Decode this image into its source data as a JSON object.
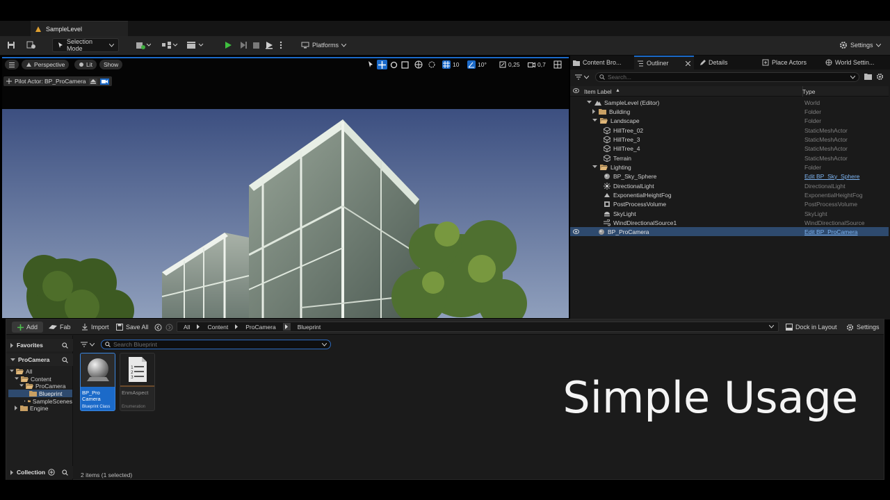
{
  "level_tab": {
    "title": "SampleLevel"
  },
  "toolbar": {
    "selection_mode": "Selection Mode",
    "platforms": "Platforms",
    "settings": "Settings"
  },
  "viewport": {
    "perspective": "Perspective",
    "lit": "Lit",
    "show": "Show",
    "grid_snap": "10",
    "rotation_snap": "10°",
    "scale_snap": "0,25",
    "camera_speed": "0,7",
    "pilot_label": "Pilot Actor: BP_ProCamera"
  },
  "right_tabs": {
    "content_browser": "Content Bro...",
    "outliner": "Outliner",
    "details": "Details",
    "place_actors": "Place Actors",
    "world_settings": "World Settin..."
  },
  "outliner": {
    "search_placeholder": "Search...",
    "col_label": "Item Label",
    "col_type": "Type",
    "rows": [
      {
        "label": "SampleLevel (Editor)",
        "type": "World"
      },
      {
        "label": "Building",
        "type": "Folder"
      },
      {
        "label": "Landscape",
        "type": "Folder"
      },
      {
        "label": "HillTree_02",
        "type": "StaticMeshActor"
      },
      {
        "label": "HillTree_3",
        "type": "StaticMeshActor"
      },
      {
        "label": "HillTree_4",
        "type": "StaticMeshActor"
      },
      {
        "label": "Terrain",
        "type": "StaticMeshActor"
      },
      {
        "label": "Lighting",
        "type": "Folder"
      },
      {
        "label": "BP_Sky_Sphere",
        "type": "Edit BP_Sky_Sphere"
      },
      {
        "label": "DirectionalLight",
        "type": "DirectionalLight"
      },
      {
        "label": "ExponentialHeightFog",
        "type": "ExponentialHeightFog"
      },
      {
        "label": "PostProcessVolume",
        "type": "PostProcessVolume"
      },
      {
        "label": "SkyLight",
        "type": "SkyLight"
      },
      {
        "label": "WindDirectionalSource1",
        "type": "WindDirectionalSource"
      },
      {
        "label": "BP_ProCamera",
        "type": "Edit BP_ProCamera"
      }
    ]
  },
  "content_browser": {
    "add": "Add",
    "fab": "Fab",
    "import": "Import",
    "save_all": "Save All",
    "breadcrumb": [
      "All",
      "Content",
      "ProCamera",
      "Blueprint"
    ],
    "dock": "Dock in Layout",
    "settings": "Settings",
    "favorites": "Favorites",
    "procamera": "ProCamera",
    "collection": "Collection",
    "tree": [
      "All",
      "Content",
      "ProCamera",
      "Blueprint",
      "SampleScenes",
      "Engine"
    ],
    "search_placeholder": "Search Blueprint",
    "assets": [
      {
        "name": "BP_Pro Camera",
        "class": "Blueprint Class"
      },
      {
        "name": "EnmAspect",
        "class": "Enumeration"
      }
    ],
    "status": "2 items (1 selected)"
  },
  "overlay_text": "Simple Usage"
}
